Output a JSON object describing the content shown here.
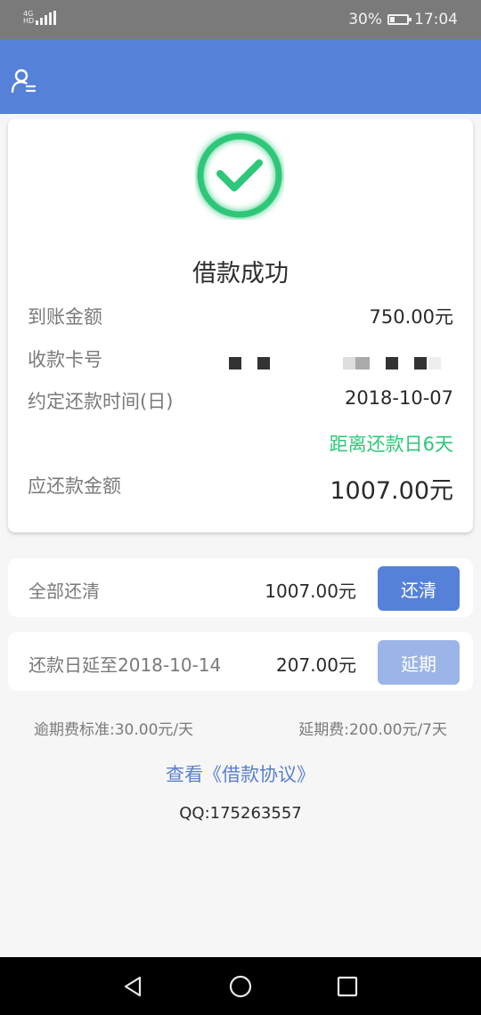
{
  "status_bar": {
    "network": "4G",
    "network_sub": "HD",
    "battery_percent": "30%",
    "battery_level": 0.3,
    "time": "17:04"
  },
  "header": {
    "icon": "user-list-icon",
    "accent_color": "#5681d8"
  },
  "result": {
    "icon": "check-circle-icon",
    "icon_color": "#2dc779",
    "title": "借款成功",
    "rows": [
      {
        "label": "到账金额",
        "value": "750.00元"
      },
      {
        "label": "收款卡号",
        "value": ""
      },
      {
        "label": "约定还款时间(日)",
        "value": "2018-10-07"
      }
    ],
    "countdown": "距离还款日6天",
    "countdown_color": "#2dc779",
    "due_label": "应还款金额",
    "due_value": "1007.00元"
  },
  "options": [
    {
      "label": "全部还清",
      "amount": "1007.00元",
      "button": "还清"
    },
    {
      "label": "还款日延至2018-10-14",
      "amount": "207.00元",
      "button": "延期"
    }
  ],
  "fees": {
    "overdue": "逾期费标准:30.00元/天",
    "extension": "延期费:200.00元/7天"
  },
  "agreement_link": "查看《借款协议》",
  "contact": "QQ:175263557",
  "nav": {
    "back": "back-icon",
    "home": "home-icon",
    "recent": "recent-apps-icon"
  }
}
